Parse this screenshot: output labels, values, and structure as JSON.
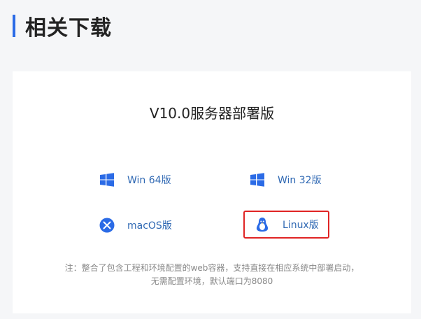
{
  "section": {
    "title": "相关下载"
  },
  "card": {
    "title": "V10.0服务器部署版",
    "downloads": [
      {
        "label": "Win 64版",
        "icon": "windows-icon"
      },
      {
        "label": "Win 32版",
        "icon": "windows-icon"
      },
      {
        "label": "macOS版",
        "icon": "macos-icon"
      },
      {
        "label": "Linux版",
        "icon": "linux-icon"
      }
    ],
    "note": "注：整合了包含工程和环境配置的web容器，支持直接在相应系统中部署启动，无需配置环境，默认端口为8080"
  },
  "colors": {
    "accent": "#2b6be6",
    "link": "#2f68b3",
    "highlight_border": "#e02424"
  }
}
